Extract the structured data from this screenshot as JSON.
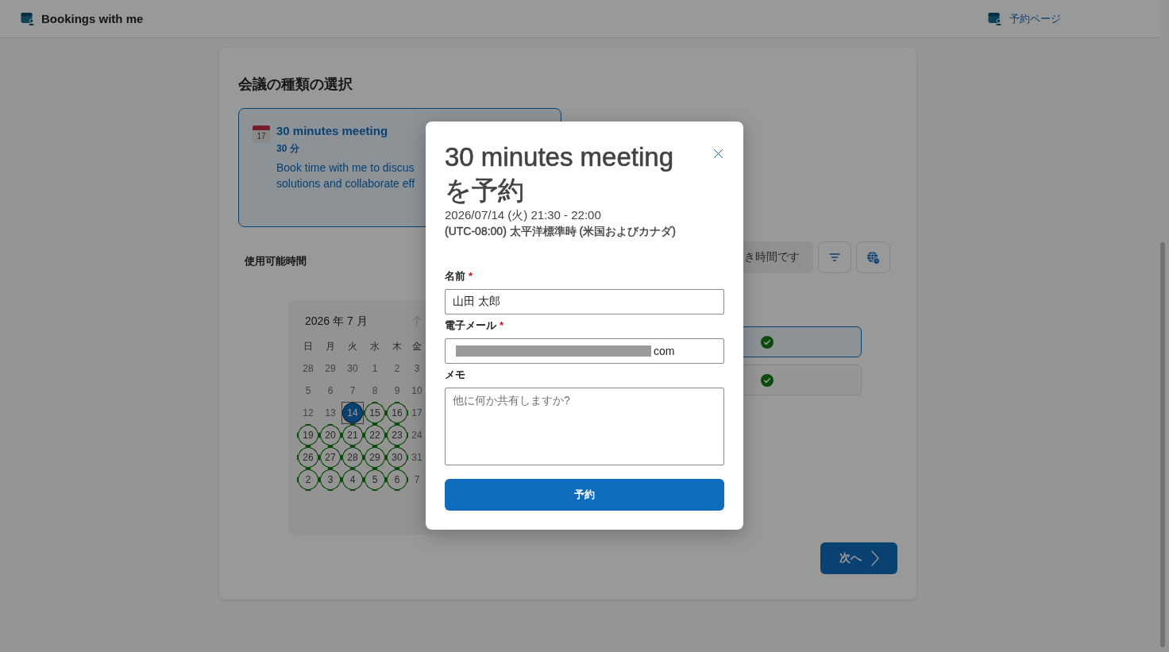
{
  "header": {
    "app_title": "Bookings with me",
    "booking_page_link": "予約ページ"
  },
  "meeting_selection": {
    "title": "会議の種類の選択",
    "meeting_types": [
      {
        "title": "30 minutes meeting",
        "icon_day": "17",
        "duration": "30 分",
        "description": "Book time with me to discus solutions and collaborate eff",
        "selected": true
      }
    ]
  },
  "availability": {
    "label": "使用可能時間",
    "time_filter": "き時間です",
    "calendar": {
      "month": "2026 年 7 月",
      "previous_month_disabled": true,
      "weekdays": [
        "日",
        "月",
        "火",
        "水",
        "木",
        "金"
      ],
      "days": [
        {
          "label": "28",
          "available": false,
          "selected": false
        },
        {
          "label": "29",
          "available": false,
          "selected": false
        },
        {
          "label": "30",
          "available": false,
          "selected": false
        },
        {
          "label": "1",
          "available": false,
          "selected": false
        },
        {
          "label": "2",
          "available": false,
          "selected": false
        },
        {
          "label": "3",
          "available": false,
          "selected": false
        },
        {
          "label": "5",
          "available": false,
          "selected": false
        },
        {
          "label": "6",
          "available": false,
          "selected": false
        },
        {
          "label": "7",
          "available": false,
          "selected": false
        },
        {
          "label": "8",
          "available": false,
          "selected": false
        },
        {
          "label": "9",
          "available": false,
          "selected": false
        },
        {
          "label": "10",
          "available": false,
          "selected": false
        },
        {
          "label": "12",
          "available": false,
          "selected": false
        },
        {
          "label": "13",
          "available": false,
          "selected": false
        },
        {
          "label": "14",
          "available": true,
          "selected": true
        },
        {
          "label": "15",
          "available": true,
          "selected": false
        },
        {
          "label": "16",
          "available": true,
          "selected": false
        },
        {
          "label": "17",
          "available": false,
          "selected": false
        },
        {
          "label": "19",
          "available": true,
          "selected": false
        },
        {
          "label": "20",
          "available": true,
          "selected": false
        },
        {
          "label": "21",
          "available": true,
          "selected": false
        },
        {
          "label": "22",
          "available": true,
          "selected": false
        },
        {
          "label": "23",
          "available": true,
          "selected": false
        },
        {
          "label": "24",
          "available": false,
          "selected": false
        },
        {
          "label": "26",
          "available": true,
          "selected": false
        },
        {
          "label": "27",
          "available": true,
          "selected": false
        },
        {
          "label": "28",
          "available": true,
          "selected": false
        },
        {
          "label": "29",
          "available": true,
          "selected": false
        },
        {
          "label": "30",
          "available": true,
          "selected": false
        },
        {
          "label": "31",
          "available": false,
          "selected": false
        },
        {
          "label": "2",
          "available": true,
          "selected": false
        },
        {
          "label": "3",
          "available": true,
          "selected": false
        },
        {
          "label": "4",
          "available": true,
          "selected": false
        },
        {
          "label": "5",
          "available": true,
          "selected": false
        },
        {
          "label": "6",
          "available": true,
          "selected": false
        },
        {
          "label": "7",
          "available": false,
          "selected": false
        }
      ]
    },
    "time_slots": [
      {
        "selected": true
      },
      {
        "selected": false
      }
    ]
  },
  "next_button": "次へ",
  "dialog": {
    "title": "30 minutes meeting を予約",
    "date_time": "2026/07/14 (火) 21:30 - 22:00",
    "time_zone": "(UTC-08:00) 太平洋標準時 (米国およびカナダ)",
    "fields": [
      {
        "kind": "text",
        "label": "名前",
        "required_mark": "*",
        "value": "山田 太郎"
      },
      {
        "kind": "email",
        "label": "電子メール",
        "required_mark": "*",
        "value": "com",
        "redacted": true
      },
      {
        "kind": "textarea",
        "label": "メモ",
        "placeholder": "他に何か共有しますか?"
      }
    ],
    "submit_button": "予約"
  }
}
